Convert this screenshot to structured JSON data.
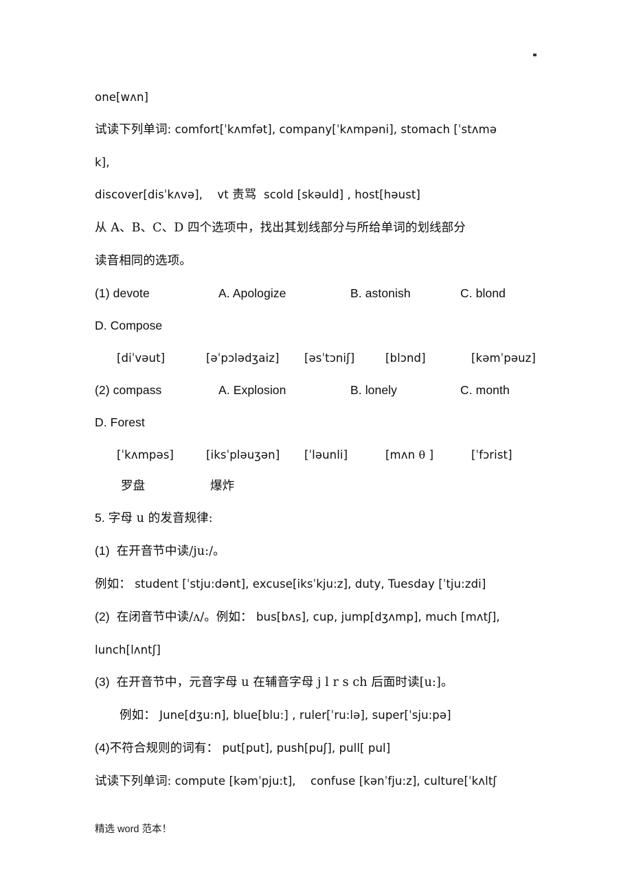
{
  "document": {
    "header_mark": "·",
    "footer_note_cjk_1": "精选",
    "footer_note_latin": " word ",
    "footer_note_cjk_2": "范本！"
  },
  "body": {
    "line_one_example": "one[wʌn]",
    "practice_label_1_cjk": "试读下列单词",
    "practice_label_1_rest": ": comfort[ˈkʌmfət], company[ˈkʌmpəni], stomach [ˈstʌmə",
    "practice_line_1_wrap": "k],",
    "discover_line_a": "discover[disˈkʌvə],    vt ",
    "discover_line_cjk": "责骂",
    "discover_line_b": "  scold [skəuld] , host[həust]",
    "instruction_cjk_line_1": "从 A、B、C、D 四个选项中，找出其划线部分与所给单词的划线部分",
    "instruction_cjk_line_2": "读音相同的选项。"
  },
  "questions": [
    {
      "number": "(1)",
      "stem": "devote",
      "options": [
        "A. Apologize",
        "B. astonish",
        "C. blond",
        "D. Compose"
      ],
      "option_d_line": "D. Compose",
      "phonetics": [
        "[diˈvəut]",
        "[əˈpɔlədʒaiz]",
        "[əsˈtɔniʃ]",
        "[blɔnd]",
        "[kəmˈpəuz]"
      ],
      "glosses": []
    },
    {
      "number": "(2)",
      "stem": "compass",
      "options": [
        "A. Explosion",
        "B. lonely",
        "C. month",
        "D. Forest"
      ],
      "option_d_line": "D. Forest",
      "phonetics_pre_theta": [
        "[ˈkʌmpəs]",
        "[iksˈpləuʒən]",
        "[ˈləunli]"
      ],
      "phonetic_month_prefix": "[mʌn ",
      "phonetic_month_theta": "θ",
      "phonetic_month_suffix": " ]",
      "phonetic_forest": "[ˈfɔrist]",
      "glosses": [
        "罗盘",
        "爆炸"
      ]
    }
  ],
  "section5": {
    "heading_number": "5. ",
    "heading_cjk": "字母 u 的发音规律:",
    "rule1_number": "(1)  ",
    "rule1_cjk": "在开音节中读/ju:/。",
    "rule1_example_cjk": "例如：",
    "rule1_example_rest": " student [ˈstju:dənt], excuse[iksˈkju:z], duty, Tuesday [ˈtju:zdi]",
    "rule2_number": "(2)  ",
    "rule2_cjk": "在闭音节中读/ʌ/。例如：",
    "rule2_rest": " bus[bʌs], cup, jump[dʒʌmp], much [mʌtʃ],",
    "rule2_wrap": "lunch[lʌntʃ]",
    "rule3_number": "(3)  ",
    "rule3_cjk": "在开音节中，元音字母 u 在辅音字母 j l r s ch 后面时读[u:]。",
    "rule3_example_cjk": "例如：",
    "rule3_example_rest": " June[dʒu:n], blue[blu:] , ruler[ˈru:lə], super[ˈsju:pə]",
    "rule4_number": "(4)",
    "rule4_cjk": "不符合规则的词有：",
    "rule4_rest": " put[put], push[puʃ], pull[ pul]",
    "practice_label_cjk": "试读下列单词",
    "practice_rest": ": compute [kəmˈpju:t],    confuse [kənˈfju:z], culture[ˈkʌltʃ"
  }
}
